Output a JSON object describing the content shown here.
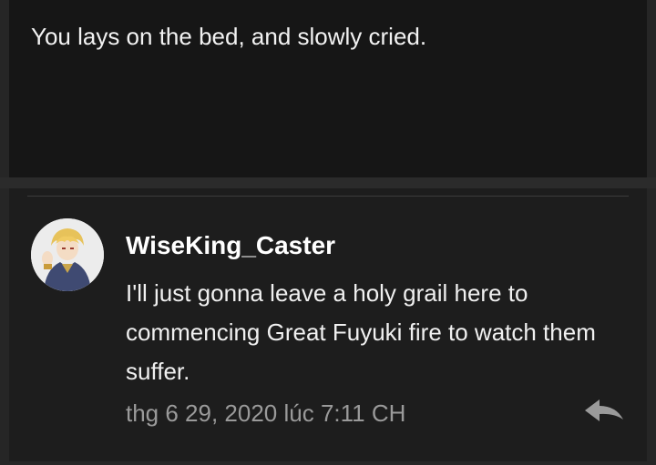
{
  "post": {
    "text": "You lays on the bed, and slowly cried."
  },
  "comment": {
    "username": "WiseKing_Caster",
    "text": "I'll just gonna leave a holy grail here to commencing Great Fuyuki fire to watch them suffer.",
    "timestamp": "thg 6 29, 2020 lúc 7:11 CH",
    "avatar_icon": "avatar-image",
    "reply_icon": "reply-icon"
  },
  "colors": {
    "background": "#161616",
    "comment_background": "#1d1d1d",
    "text": "#f0f0f0",
    "muted": "#9a9a9a"
  }
}
